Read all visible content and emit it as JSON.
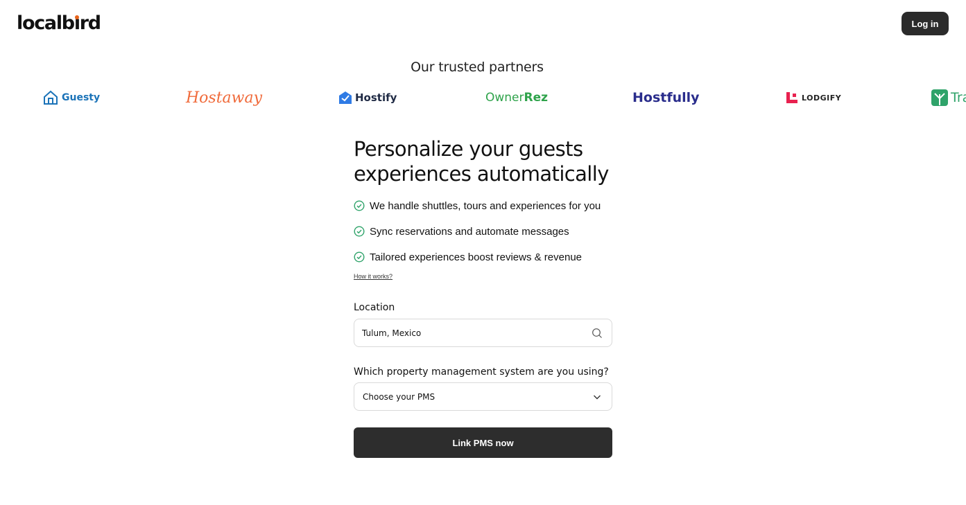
{
  "header": {
    "logo_text_pre": "localb",
    "logo_text_i": "ı",
    "logo_text_post": "rd",
    "login_label": "Log in"
  },
  "partners": {
    "title": "Our trusted partners",
    "items": [
      {
        "name": "Guesty"
      },
      {
        "name": "Hostaway"
      },
      {
        "name": "Hostify"
      },
      {
        "name_a": "Owner",
        "name_b": "Rez"
      },
      {
        "name": "Hostfully"
      },
      {
        "name": "LODGIFY"
      },
      {
        "name": "Track"
      }
    ]
  },
  "hero": {
    "title_line1": "Personalize your guests",
    "title_line2": "experiences automatically",
    "benefits": [
      "We handle shuttles, tours and experiences for you",
      "Sync reservations and automate messages",
      "Tailored experiences boost reviews & revenue"
    ],
    "how_link": "How it works?"
  },
  "form": {
    "location_label": "Location",
    "location_value": "Tulum, Mexico",
    "pms_label": "Which property management system are you using?",
    "pms_value": "Choose your PMS",
    "submit_label": "Link PMS now"
  },
  "icons": {
    "check": "check-circle-icon",
    "search": "search-icon",
    "chevron": "chevron-down-icon"
  },
  "colors": {
    "accent_green": "#2fa36a",
    "primary_dark": "#2d2d2d",
    "logo_dot": "#e8641b"
  }
}
